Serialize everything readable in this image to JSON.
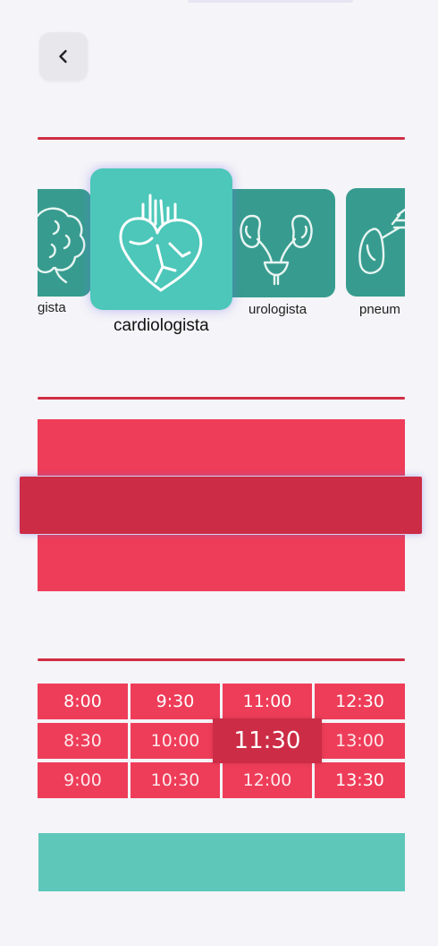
{
  "header": {
    "back_icon": "chevron-left-icon"
  },
  "specialties": [
    {
      "label": "gista",
      "icon": "brain-icon"
    },
    {
      "label": "cardiologista",
      "icon": "heart-icon",
      "selected": true
    },
    {
      "label": "urologista",
      "icon": "kidneys-icon"
    },
    {
      "label": "pneum",
      "icon": "lungs-icon"
    }
  ],
  "times": {
    "selected": "11:30",
    "columns": [
      [
        "8:00",
        "8:30",
        "9:00"
      ],
      [
        "9:30",
        "10:00",
        "10:30"
      ],
      [
        "11:00",
        "11:30",
        "12:00"
      ],
      [
        "12:30",
        "13:00",
        "13:30"
      ]
    ]
  },
  "colors": {
    "accent_red": "#ee3d59",
    "dark_red": "#cc2c45",
    "teal": "#4cc7b9",
    "teal_dark": "#379c8f",
    "teal_button": "#5ec7ba",
    "background": "#f5f4f8"
  }
}
